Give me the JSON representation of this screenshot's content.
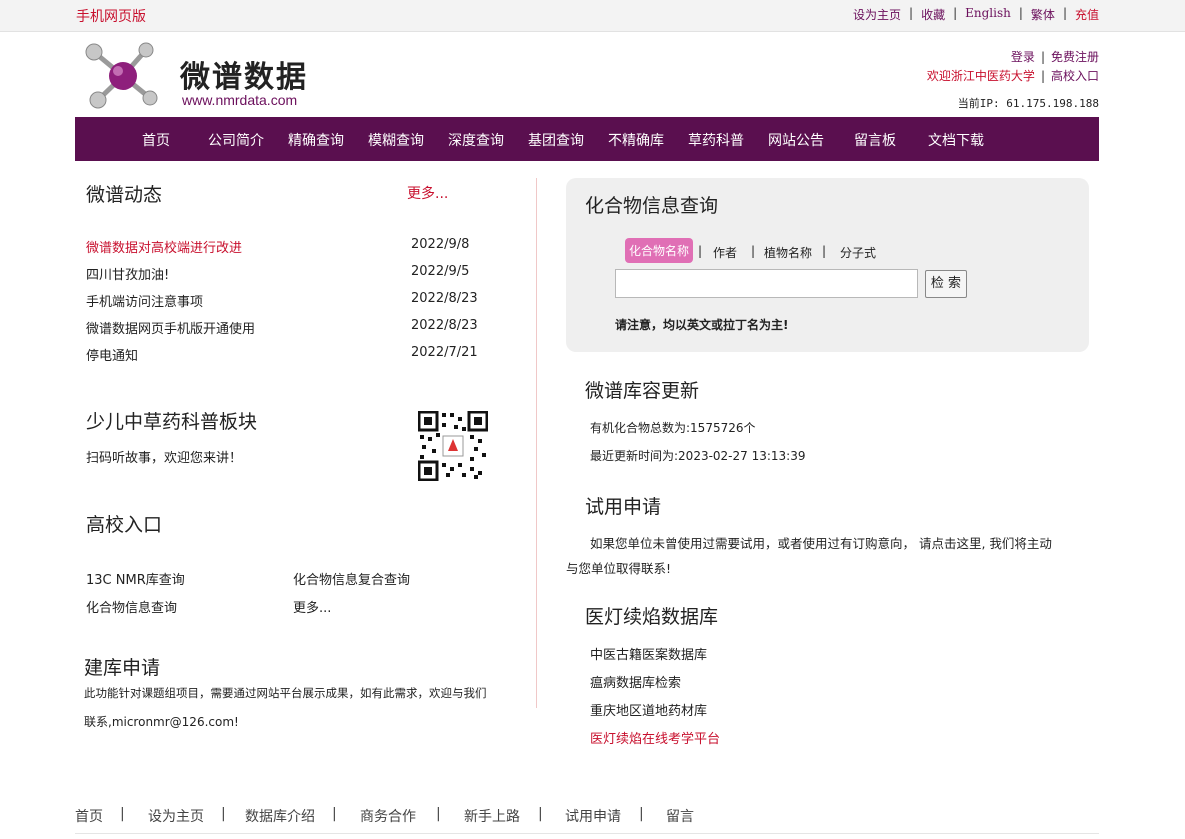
{
  "topbar": {
    "mobile_link": "手机网页版",
    "set_home": "设为主页",
    "favorite": "收藏",
    "english": "English",
    "traditional": "繁体",
    "recharge": "充值"
  },
  "logo": {
    "title": "微谱数据",
    "url": "www.nmrdata.com"
  },
  "account": {
    "login": "登录",
    "register": "免费注册",
    "welcome": "欢迎浙江中医药大学",
    "campus_entry": "高校入口",
    "ip_label": "当前IP: 61.175.198.188"
  },
  "nav": [
    "首页",
    "公司简介",
    "精确查询",
    "模糊查询",
    "深度查询",
    "基团查询",
    "不精确库",
    "草药科普",
    "网站公告",
    "留言板",
    "文档下载"
  ],
  "news": {
    "title": "微谱动态",
    "more": "更多...",
    "items": [
      {
        "title": "微谱数据对高校端进行改进",
        "date": "2022/9/8"
      },
      {
        "title": "四川甘孜加油!",
        "date": "2022/9/5"
      },
      {
        "title": "手机端访问注意事项",
        "date": "2022/8/23"
      },
      {
        "title": "微谱数据网页手机版开通使用",
        "date": "2022/8/23"
      },
      {
        "title": "停电通知",
        "date": "2022/7/21"
      }
    ]
  },
  "herb": {
    "title": "少儿中草药科普板块",
    "text": "扫码听故事，欢迎您来讲！"
  },
  "campus": {
    "title": "高校入口",
    "links": [
      "13C NMR库查询",
      "化合物信息复合查询",
      "化合物信息查询",
      "更多..."
    ]
  },
  "build": {
    "title": "建库申请",
    "line1": "此功能针对课题组项目，需要通过网站平台展示成果，如有此需求，欢迎与我们",
    "line2": "联系,micronmr@126.com!"
  },
  "compound_search": {
    "title": "化合物信息查询",
    "tabs": [
      "化合物名称",
      "作者",
      "植物名称",
      "分子式"
    ],
    "input_value": "",
    "button": "检 索",
    "notice": "请注意，均以英文或拉丁名为主!"
  },
  "update": {
    "title": "微谱库容更新",
    "total": "有机化合物总数为:1575726个",
    "last_update": "最近更新时间为:2023-02-27 13:13:39"
  },
  "trial": {
    "title": "试用申请",
    "line1": "如果您单位未曾使用过需要试用，或者使用过有订购意向， 请点击这里, 我们将主动",
    "line2": "与您单位取得联系!"
  },
  "tcm_db": {
    "title": "医灯续焰数据库",
    "links": [
      "中医古籍医案数据库",
      "瘟病数据库检索",
      "重庆地区道地药材库",
      "医灯续焰在线考学平台"
    ]
  },
  "footer": [
    "首页",
    "|",
    "设为主页",
    "|",
    "数据库介绍",
    "|",
    "商务合作",
    "|",
    "新手上路",
    "|",
    "试用申请",
    "|",
    "留言"
  ],
  "colors": {
    "brand_purple": "#5a0f4f",
    "accent_red": "#c8102e",
    "tab_active_pink": "#e06fb5"
  }
}
